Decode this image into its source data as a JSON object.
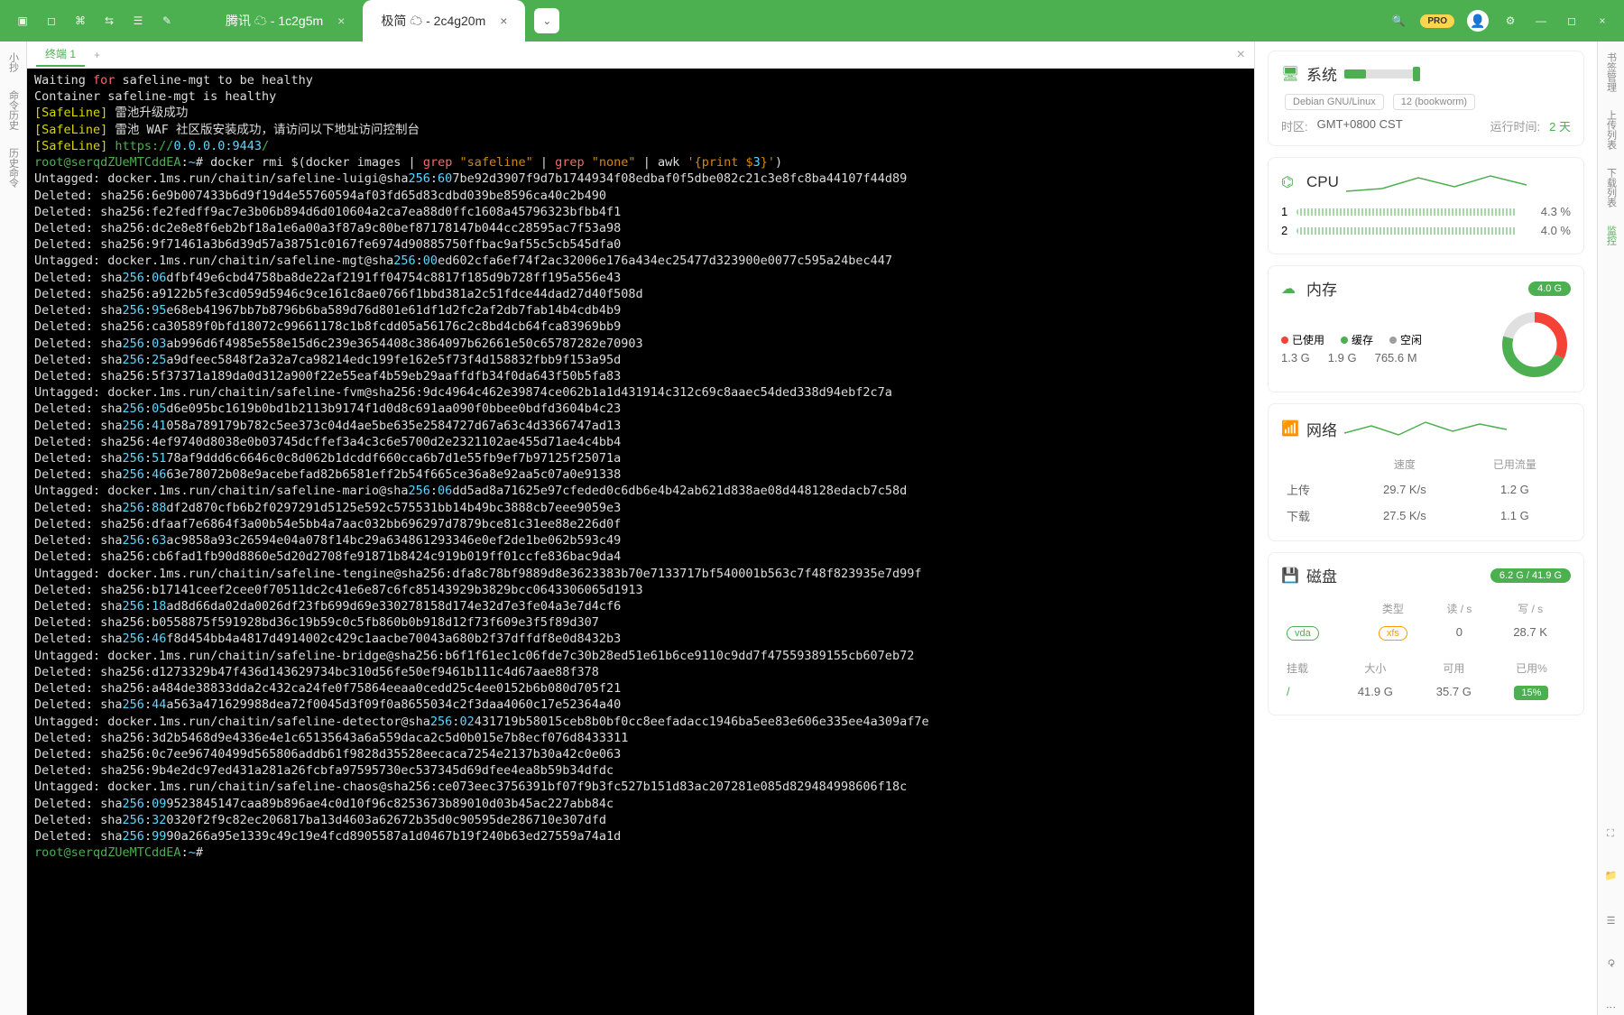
{
  "titlebar": {
    "tabs": [
      {
        "label": "腾讯 ☁ - 1c2g5m",
        "active": false
      },
      {
        "label": "极简 ☁ - 2c4g20m",
        "active": true
      }
    ],
    "pro": "PRO"
  },
  "leftbar": {
    "items": [
      "小抄",
      "命令历史",
      "历史命令"
    ]
  },
  "rightbar": {
    "items": [
      "书签管理",
      "上传列表",
      "下载列表",
      "监控"
    ]
  },
  "termtab": {
    "label": "终端 1"
  },
  "terminal": {
    "lines": [
      [
        [
          "",
          "Waiting "
        ],
        [
          "r",
          "for"
        ],
        [
          "",
          " safeline-mgt to be healthy"
        ]
      ],
      [
        [
          "",
          "Container safeline-mgt is healthy"
        ]
      ],
      [
        [
          "y",
          "[SafeLine] "
        ],
        [
          "",
          "雷池升级成功"
        ]
      ],
      [
        [
          "y",
          "[SafeLine] "
        ],
        [
          "",
          "雷池 WAF 社区版安装成功，请访问以下地址访问控制台"
        ]
      ],
      [
        [
          "y",
          "[SafeLine] "
        ],
        [
          "g",
          "https://"
        ],
        [
          "b",
          "0.0.0.0:9443"
        ],
        [
          "g",
          "/"
        ]
      ],
      [
        [
          "g",
          "root@serqdZUeMTCddEA"
        ],
        [
          "",
          ":"
        ],
        [
          "b",
          "~"
        ],
        [
          "",
          "# docker rmi $(docker images | "
        ],
        [
          "r",
          "grep"
        ],
        [
          "",
          " "
        ],
        [
          "o",
          "\"safeline\""
        ],
        [
          "",
          " | "
        ],
        [
          "r",
          "grep"
        ],
        [
          "",
          " "
        ],
        [
          "o",
          "\"none\""
        ],
        [
          "",
          " | awk "
        ],
        [
          "o",
          "'{print $"
        ],
        [
          "b",
          "3"
        ],
        [
          "o",
          "}'"
        ],
        [
          "",
          ")"
        ]
      ],
      [
        [
          "",
          "Untagged: docker.1ms.run/chaitin/safeline-luigi@sha"
        ],
        [
          "b",
          "256"
        ],
        [
          "",
          ":"
        ],
        [
          "b",
          "60"
        ],
        [
          "",
          "7be92d3907f9d7b1744934f08edbaf0f5dbe082c21c3e8fc8ba44107f44d89"
        ]
      ],
      [
        [
          "",
          "Deleted: sha256:6e9b007433b6d9f19d4e55760594af03fd65d83cdbd039be8596ca40c2b490"
        ]
      ],
      [
        [
          "",
          "Deleted: sha256:fe2fedff9ac7e3b06b894d6d010604a2ca7ea88d0ffc1608a45796323bfbb4f1"
        ]
      ],
      [
        [
          "",
          "Deleted: sha256:dc2e8e8f6eb2bf18a1e6a00a3f87a9c80bef87178147b044cc28595ac7f53a98"
        ]
      ],
      [
        [
          "",
          "Deleted: sha256:9f71461a3b6d39d57a38751c0167fe6974d90885750ffbac9af55c5cb545dfa0"
        ]
      ],
      [
        [
          "",
          "Untagged: docker.1ms.run/chaitin/safeline-mgt@sha"
        ],
        [
          "b",
          "256"
        ],
        [
          "",
          ":"
        ],
        [
          "b",
          "00"
        ],
        [
          "",
          "ed602cfa6ef74f2ac32006e176a434ec25477d323900e0077c595a24bec447"
        ]
      ],
      [
        [
          "",
          "Deleted: sha"
        ],
        [
          "b",
          "256"
        ],
        [
          "",
          ":"
        ],
        [
          "b",
          "06"
        ],
        [
          "",
          "dfbf49e6cbd4758ba8de22af2191ff04754c8817f185d9b728ff195a556e43"
        ]
      ],
      [
        [
          "",
          "Deleted: sha256:a9122b5fe3cd059d5946c9ce161c8ae0766f1bbd381a2c51fdce44dad27d40f508d"
        ]
      ],
      [
        [
          "",
          "Deleted: sha"
        ],
        [
          "b",
          "256"
        ],
        [
          "",
          ":"
        ],
        [
          "b",
          "95"
        ],
        [
          "",
          "e68eb41967bb7b8796b6ba589d76d801e61df1d2fc2af2db7fab14b4cdb4b9"
        ]
      ],
      [
        [
          "",
          "Deleted: sha256:ca30589f0bfd18072c99661178c1b8fcdd05a56176c2c8bd4cb64fca83969bb9"
        ]
      ],
      [
        [
          "",
          "Deleted: sha"
        ],
        [
          "b",
          "256"
        ],
        [
          "",
          ":"
        ],
        [
          "b",
          "03"
        ],
        [
          "",
          "ab996d6f4985e558e15d6c239e3654408c3864097b62661e50c65787282e70903"
        ]
      ],
      [
        [
          "",
          "Deleted: sha"
        ],
        [
          "b",
          "256"
        ],
        [
          "",
          ":"
        ],
        [
          "b",
          "25"
        ],
        [
          "",
          "a9dfeec5848f2a32a7ca98214edc199fe162e5f73f4d158832fbb9f153a95d"
        ]
      ],
      [
        [
          "",
          "Deleted: sha256:5f37371a189da0d312a900f22e55eaf4b59eb29aaffdfb34f0da643f50b5fa83"
        ]
      ],
      [
        [
          "",
          "Untagged: docker.1ms.run/chaitin/safeline-fvm@sha256:9dc4964c462e39874ce062b1a1d431914c312c69c8aaec54ded338d94ebf2c7a"
        ]
      ],
      [
        [
          "",
          "Deleted: sha"
        ],
        [
          "b",
          "256"
        ],
        [
          "",
          ":"
        ],
        [
          "b",
          "05"
        ],
        [
          "",
          "d6e095bc1619b0bd1b2113b9174f1d0d8c691aa090f0bbee0bdfd3604b4c23"
        ]
      ],
      [
        [
          "",
          "Deleted: sha"
        ],
        [
          "b",
          "256"
        ],
        [
          "",
          ":"
        ],
        [
          "b",
          "41"
        ],
        [
          "",
          "058a789179b782c5ee373c04d4ae5be635e2584727d67a63c4d3366747ad13"
        ]
      ],
      [
        [
          "",
          "Deleted: sha256:4ef9740d8038e0b03745dcffef3a4c3c6e5700d2e2321102ae455d71ae4c4bb4"
        ]
      ],
      [
        [
          "",
          "Deleted: sha"
        ],
        [
          "b",
          "256"
        ],
        [
          "",
          ":"
        ],
        [
          "b",
          "51"
        ],
        [
          "",
          "78af9ddd6c6646c0c8d062b1dcddf660cca6b7d1e55fb9ef7b97125f25071a"
        ]
      ],
      [
        [
          "",
          "Deleted: sha"
        ],
        [
          "b",
          "256"
        ],
        [
          "",
          ":"
        ],
        [
          "b",
          "46"
        ],
        [
          "",
          "63e78072b08e9acebefad82b6581eff2b54f665ce36a8e92aa5c07a0e91338"
        ]
      ],
      [
        [
          "",
          "Untagged: docker.1ms.run/chaitin/safeline-mario@sha"
        ],
        [
          "b",
          "256"
        ],
        [
          "",
          ":"
        ],
        [
          "b",
          "06"
        ],
        [
          "",
          "dd5ad8a71625e97cfeded0c6db6e4b42ab621d838ae08d448128edacb7c58d"
        ]
      ],
      [
        [
          "",
          "Deleted: sha"
        ],
        [
          "b",
          "256"
        ],
        [
          "",
          ":"
        ],
        [
          "b",
          "88"
        ],
        [
          "",
          "df2d870cfb6b2f0297291d5125e592c575531bb14b49bc3888cb7eee9059e3"
        ]
      ],
      [
        [
          "",
          "Deleted: sha256:dfaaf7e6864f3a00b54e5bb4a7aac032bb696297d7879bce81c31ee88e226d0f"
        ]
      ],
      [
        [
          "",
          "Deleted: sha"
        ],
        [
          "b",
          "256"
        ],
        [
          "",
          ":"
        ],
        [
          "b",
          "63"
        ],
        [
          "",
          "ac9858a93c26594e04a078f14bc29a634861293346e0ef2de1be062b593c49"
        ]
      ],
      [
        [
          "",
          "Deleted: sha256:cb6fad1fb90d8860e5d20d2708fe91871b8424c919b019ff01ccfe836bac9da4"
        ]
      ],
      [
        [
          "",
          "Untagged: docker.1ms.run/chaitin/safeline-tengine@sha256:dfa8c78bf9889d8e3623383b70e7133717bf540001b563c7f48f823935e7d99f"
        ]
      ],
      [
        [
          "",
          "Deleted: sha256:b17141ceef2cee0f70511dc2c41e6e87c6fc85143929b3829bcc0643306065d1913"
        ]
      ],
      [
        [
          "",
          "Deleted: sha"
        ],
        [
          "b",
          "256"
        ],
        [
          "",
          ":"
        ],
        [
          "b",
          "18"
        ],
        [
          "",
          "ad8d66da02da0026df23fb699d69e330278158d174e32d7e3fe04a3e7d4cf6"
        ]
      ],
      [
        [
          "",
          "Deleted: sha256:b0558875f591928bd36c19b59c0c5fb860b0b918d12f73f609e3f5f89d307"
        ]
      ],
      [
        [
          "",
          "Deleted: sha"
        ],
        [
          "b",
          "256"
        ],
        [
          "",
          ":"
        ],
        [
          "b",
          "46"
        ],
        [
          "",
          "f8d454bb4a4817d4914002c429c1aacbe70043a680b2f37dffdf8e0d8432b3"
        ]
      ],
      [
        [
          "",
          "Untagged: docker.1ms.run/chaitin/safeline-bridge@sha256:b6f1f61ec1c06fde7c30b28ed51e61b6ce9110c9dd7f47559389155cb607eb72"
        ]
      ],
      [
        [
          "",
          "Deleted: sha256:d1273329b47f436d143629734bc310d56fe50ef9461b111c4d67aae88f378"
        ]
      ],
      [
        [
          "",
          "Deleted: sha256:a484de38833dda2c432ca24fe0f75864eeaa0cedd25c4ee0152b6b080d705f21"
        ]
      ],
      [
        [
          "",
          "Deleted: sha"
        ],
        [
          "b",
          "256"
        ],
        [
          "",
          ":"
        ],
        [
          "b",
          "44"
        ],
        [
          "",
          "a563a471629988dea72f0045d3f09f0a8655034c2f3daa4060c17e52364a40"
        ]
      ],
      [
        [
          "",
          "Untagged: docker.1ms.run/chaitin/safeline-detector@sha"
        ],
        [
          "b",
          "256"
        ],
        [
          "",
          ":"
        ],
        [
          "b",
          "02"
        ],
        [
          "",
          "431719b58015ceb8b0bf0cc8eefadacc1946ba5ee83e606e335ee4a309af7e"
        ]
      ],
      [
        [
          "",
          "Deleted: sha256:3d2b5468d9e4336e4e1c65135643a6a559daca2c5d0b015e7b8ecf076d8433311"
        ]
      ],
      [
        [
          "",
          "Deleted: sha256:0c7ee96740499d565806addb61f9828d35528eecaca7254e2137b30a42c0e063"
        ]
      ],
      [
        [
          "",
          "Deleted: sha256:9b4e2dc97ed431a281a26fcbfa97595730ec537345d69dfee4ea8b59b34dfdc"
        ]
      ],
      [
        [
          "",
          "Untagged: docker.1ms.run/chaitin/safeline-chaos@sha256:ce073eec3756391bf07f9b3fc527b151d83ac207281e085d829484998606f18c"
        ]
      ],
      [
        [
          "",
          "Deleted: sha"
        ],
        [
          "b",
          "256"
        ],
        [
          "",
          ":"
        ],
        [
          "b",
          "09"
        ],
        [
          "",
          "9523845147caa89b896ae4c0d10f96c8253673b89010d03b45ac227abb84c"
        ]
      ],
      [
        [
          "",
          "Deleted: sha"
        ],
        [
          "b",
          "256"
        ],
        [
          "",
          ":"
        ],
        [
          "b",
          "32"
        ],
        [
          "",
          "0320f2f9c82ec206817ba13d4603a62672b35d0c90595de286710e307dfd"
        ]
      ],
      [
        [
          "",
          "Deleted: sha"
        ],
        [
          "b",
          "256"
        ],
        [
          "",
          ":"
        ],
        [
          "b",
          "99"
        ],
        [
          "",
          "90a266a95e1339c49c19e4fcd8905587a1d0467b19f240b63ed27559a74a1d"
        ]
      ],
      [
        [
          "g",
          "root@serqdZUeMTCddEA"
        ],
        [
          "",
          ":"
        ],
        [
          "b",
          "~"
        ],
        [
          "",
          "# "
        ]
      ]
    ]
  },
  "system": {
    "title": "系统",
    "os": "Debian GNU/Linux",
    "ver": "12 (bookworm)",
    "tz_label": "时区:",
    "tz": "GMT+0800  CST",
    "uptime_label": "运行时间:",
    "uptime": "2 天"
  },
  "cpu": {
    "title": "CPU",
    "rows": [
      {
        "id": "1",
        "pct": "4.3 %"
      },
      {
        "id": "2",
        "pct": "4.0 %"
      }
    ]
  },
  "mem": {
    "title": "内存",
    "total": "4.0 G",
    "legend": [
      {
        "label": "已使用",
        "color": "#f44336",
        "val": "1.3 G"
      },
      {
        "label": "缓存",
        "color": "#4caf50",
        "val": "1.9 G"
      },
      {
        "label": "空闲",
        "color": "#9e9e9e",
        "val": "765.6 M"
      }
    ]
  },
  "net": {
    "title": "网络",
    "h_speed": "速度",
    "h_traffic": "已用流量",
    "rows": [
      {
        "dir": "上传",
        "speed": "29.7 K/s",
        "total": "1.2 G"
      },
      {
        "dir": "下载",
        "speed": "27.5 K/s",
        "total": "1.1 G"
      }
    ]
  },
  "disk": {
    "title": "磁盘",
    "summary": "6.2 G / 41.9 G",
    "h_type": "类型",
    "h_read": "读 / s",
    "h_write": "写 / s",
    "rows": [
      {
        "dev": "vda",
        "fs": "xfs",
        "read": "0",
        "write": "28.7 K"
      }
    ],
    "h_mount": "挂载",
    "h_size": "大小",
    "h_avail": "可用",
    "h_used": "已用%",
    "mounts": [
      {
        "mount": "/",
        "size": "41.9 G",
        "avail": "35.7 G",
        "pct": "15%"
      }
    ]
  }
}
